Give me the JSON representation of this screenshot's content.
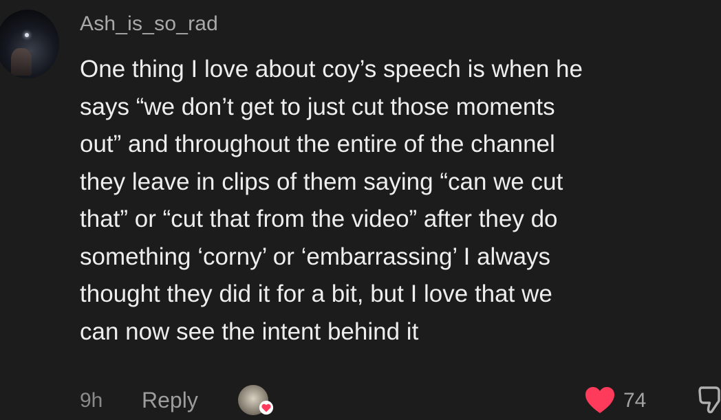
{
  "comment": {
    "username": "Ash_is_so_rad",
    "lines": [
      "One thing I love about coy’s speech is when he",
      "says “we don’t get to just cut those moments",
      "out” and throughout the entire of the channel",
      "they leave in clips of them saying “can we cut",
      "that” or “cut that from the video” after they do",
      "something ‘corny’ or ‘embarrassing’ I always",
      "thought they did it for a bit, but I love that we",
      "can now see the intent behind it"
    ],
    "timestamp": "9h",
    "reply_label": "Reply",
    "like_count": "74"
  },
  "icons": {
    "like": "heart-icon",
    "dislike": "thumbs-down-icon",
    "creator_badge": "creator-liked-avatar"
  },
  "colors": {
    "background": "#1c1c1c",
    "heart": "#ff3b5c",
    "text": "#eeeeee",
    "muted": "#a9a9a9"
  }
}
